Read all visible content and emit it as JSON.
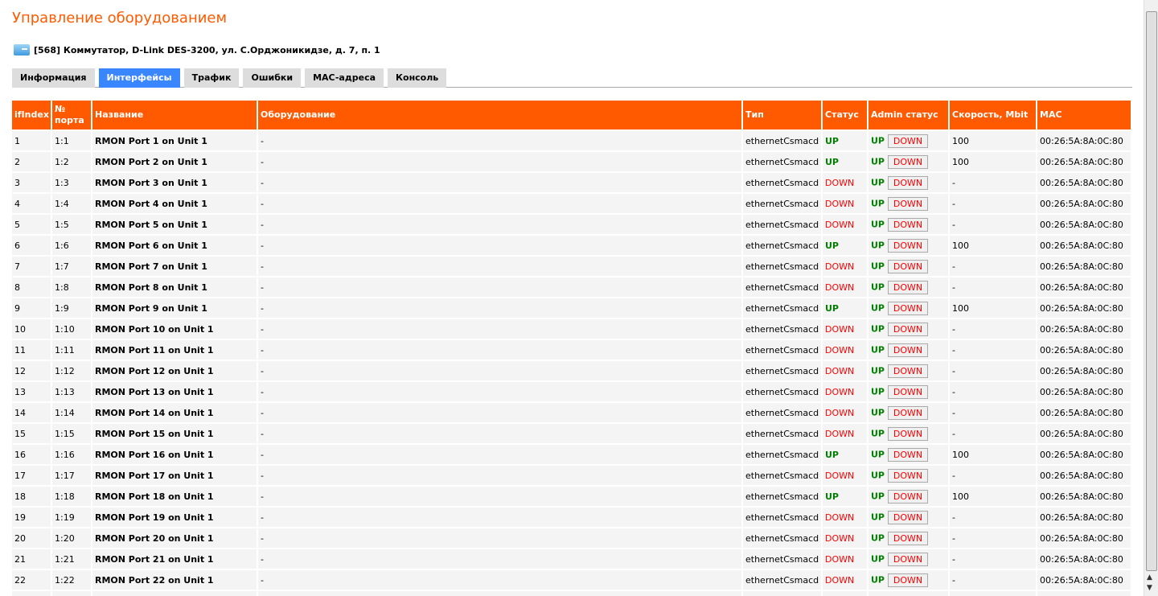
{
  "title": "Управление оборудованием",
  "device": "[568] Коммутатор, D-Link DES-3200, ул. С.Орджоникидзе, д. 7, п. 1",
  "tabs": [
    "Информация",
    "Интерфейсы",
    "Трафик",
    "Ошибки",
    "MAC-адреса",
    "Консоль"
  ],
  "active_tab": 1,
  "headers": [
    "ifIndex",
    "№ порта",
    "Название",
    "Оборудование",
    "Тип",
    "Статус",
    "Admin статус",
    "Скорость, Mbit",
    "MAC"
  ],
  "button_label": "DOWN",
  "rows": [
    [
      "1",
      "1:1",
      "RMON Port 1 on Unit 1",
      "-",
      "ethernetCsmacd",
      "UP",
      "UP",
      "100",
      "00:26:5A:8A:0C:80"
    ],
    [
      "2",
      "1:2",
      "RMON Port 2 on Unit 1",
      "-",
      "ethernetCsmacd",
      "UP",
      "UP",
      "100",
      "00:26:5A:8A:0C:80"
    ],
    [
      "3",
      "1:3",
      "RMON Port 3 on Unit 1",
      "-",
      "ethernetCsmacd",
      "DOWN",
      "UP",
      "-",
      "00:26:5A:8A:0C:80"
    ],
    [
      "4",
      "1:4",
      "RMON Port 4 on Unit 1",
      "-",
      "ethernetCsmacd",
      "DOWN",
      "UP",
      "-",
      "00:26:5A:8A:0C:80"
    ],
    [
      "5",
      "1:5",
      "RMON Port 5 on Unit 1",
      "-",
      "ethernetCsmacd",
      "DOWN",
      "UP",
      "-",
      "00:26:5A:8A:0C:80"
    ],
    [
      "6",
      "1:6",
      "RMON Port 6 on Unit 1",
      "-",
      "ethernetCsmacd",
      "UP",
      "UP",
      "100",
      "00:26:5A:8A:0C:80"
    ],
    [
      "7",
      "1:7",
      "RMON Port 7 on Unit 1",
      "-",
      "ethernetCsmacd",
      "DOWN",
      "UP",
      "-",
      "00:26:5A:8A:0C:80"
    ],
    [
      "8",
      "1:8",
      "RMON Port 8 on Unit 1",
      "-",
      "ethernetCsmacd",
      "DOWN",
      "UP",
      "-",
      "00:26:5A:8A:0C:80"
    ],
    [
      "9",
      "1:9",
      "RMON Port 9 on Unit 1",
      "-",
      "ethernetCsmacd",
      "UP",
      "UP",
      "100",
      "00:26:5A:8A:0C:80"
    ],
    [
      "10",
      "1:10",
      "RMON Port 10 on Unit 1",
      "-",
      "ethernetCsmacd",
      "DOWN",
      "UP",
      "-",
      "00:26:5A:8A:0C:80"
    ],
    [
      "11",
      "1:11",
      "RMON Port 11 on Unit 1",
      "-",
      "ethernetCsmacd",
      "DOWN",
      "UP",
      "-",
      "00:26:5A:8A:0C:80"
    ],
    [
      "12",
      "1:12",
      "RMON Port 12 on Unit 1",
      "-",
      "ethernetCsmacd",
      "DOWN",
      "UP",
      "-",
      "00:26:5A:8A:0C:80"
    ],
    [
      "13",
      "1:13",
      "RMON Port 13 on Unit 1",
      "-",
      "ethernetCsmacd",
      "DOWN",
      "UP",
      "-",
      "00:26:5A:8A:0C:80"
    ],
    [
      "14",
      "1:14",
      "RMON Port 14 on Unit 1",
      "-",
      "ethernetCsmacd",
      "DOWN",
      "UP",
      "-",
      "00:26:5A:8A:0C:80"
    ],
    [
      "15",
      "1:15",
      "RMON Port 15 on Unit 1",
      "-",
      "ethernetCsmacd",
      "DOWN",
      "UP",
      "-",
      "00:26:5A:8A:0C:80"
    ],
    [
      "16",
      "1:16",
      "RMON Port 16 on Unit 1",
      "-",
      "ethernetCsmacd",
      "UP",
      "UP",
      "100",
      "00:26:5A:8A:0C:80"
    ],
    [
      "17",
      "1:17",
      "RMON Port 17 on Unit 1",
      "-",
      "ethernetCsmacd",
      "DOWN",
      "UP",
      "-",
      "00:26:5A:8A:0C:80"
    ],
    [
      "18",
      "1:18",
      "RMON Port 18 on Unit 1",
      "-",
      "ethernetCsmacd",
      "UP",
      "UP",
      "100",
      "00:26:5A:8A:0C:80"
    ],
    [
      "19",
      "1:19",
      "RMON Port 19 on Unit 1",
      "-",
      "ethernetCsmacd",
      "DOWN",
      "UP",
      "-",
      "00:26:5A:8A:0C:80"
    ],
    [
      "20",
      "1:20",
      "RMON Port 20 on Unit 1",
      "-",
      "ethernetCsmacd",
      "DOWN",
      "UP",
      "-",
      "00:26:5A:8A:0C:80"
    ],
    [
      "21",
      "1:21",
      "RMON Port 21 on Unit 1",
      "-",
      "ethernetCsmacd",
      "DOWN",
      "UP",
      "-",
      "00:26:5A:8A:0C:80"
    ],
    [
      "22",
      "1:22",
      "RMON Port 22 on Unit 1",
      "-",
      "ethernetCsmacd",
      "DOWN",
      "UP",
      "-",
      "00:26:5A:8A:0C:80"
    ]
  ],
  "colors": {
    "accent": "#ff5a00",
    "active_tab": "#3a86ff",
    "up": "#008000",
    "down": "#ff0000"
  }
}
